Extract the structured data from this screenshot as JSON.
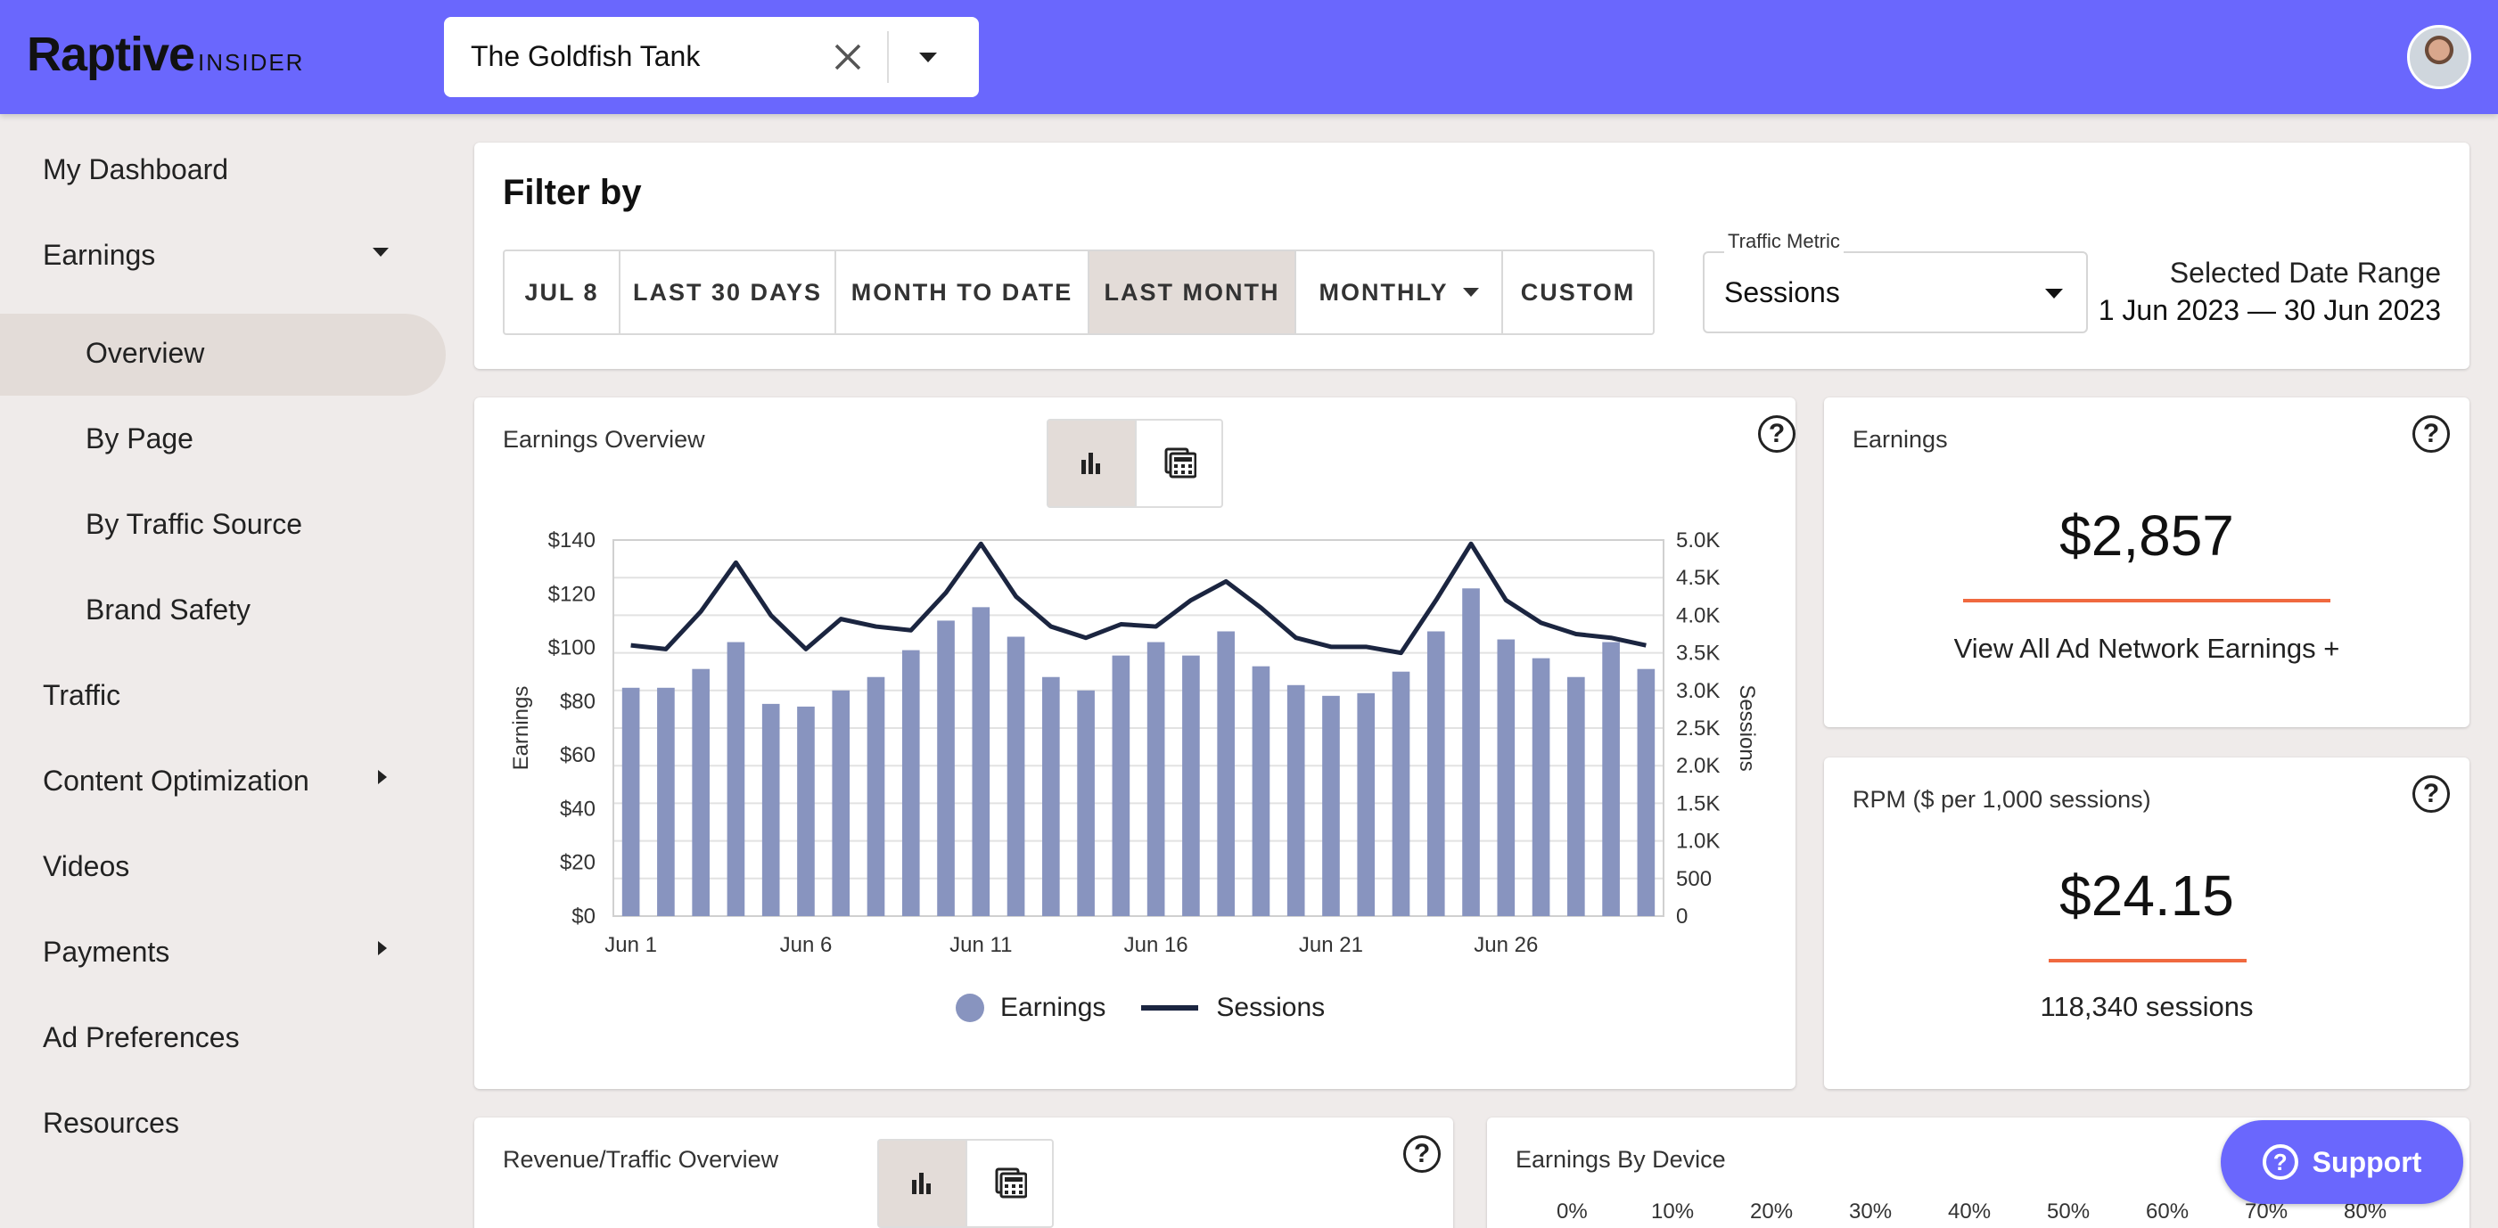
{
  "header": {
    "logo": "Raptive",
    "logo_sub": "INSIDER",
    "site_selector": {
      "value": "The Goldfish Tank"
    }
  },
  "sidebar": {
    "items": [
      {
        "label": "My Dashboard"
      },
      {
        "label": "Earnings"
      },
      {
        "label": "Overview"
      },
      {
        "label": "By Page"
      },
      {
        "label": "By Traffic Source"
      },
      {
        "label": "Brand Safety"
      },
      {
        "label": "Traffic"
      },
      {
        "label": "Content Optimization"
      },
      {
        "label": "Videos"
      },
      {
        "label": "Payments"
      },
      {
        "label": "Ad Preferences"
      },
      {
        "label": "Resources"
      }
    ]
  },
  "filter": {
    "title": "Filter by",
    "buttons": [
      "JUL 8",
      "LAST 30 DAYS",
      "MONTH TO DATE",
      "LAST MONTH",
      "MONTHLY",
      "CUSTOM"
    ],
    "active_button": "LAST MONTH",
    "traffic_metric_label": "Traffic Metric",
    "traffic_metric_value": "Sessions",
    "date_range_label": "Selected Date Range",
    "date_range_value": "1 Jun 2023 — 30 Jun 2023"
  },
  "earnings_overview": {
    "title": "Earnings Overview",
    "help": "?"
  },
  "chart_data": {
    "type": "bar",
    "title": "",
    "categories": [
      "Jun 1",
      "Jun 2",
      "Jun 3",
      "Jun 4",
      "Jun 5",
      "Jun 6",
      "Jun 7",
      "Jun 8",
      "Jun 9",
      "Jun 10",
      "Jun 11",
      "Jun 12",
      "Jun 13",
      "Jun 14",
      "Jun 15",
      "Jun 16",
      "Jun 17",
      "Jun 18",
      "Jun 19",
      "Jun 20",
      "Jun 21",
      "Jun 22",
      "Jun 23",
      "Jun 24",
      "Jun 25",
      "Jun 26",
      "Jun 27",
      "Jun 28",
      "Jun 29",
      "Jun 30"
    ],
    "x_tick_labels": [
      "Jun 1",
      "Jun 6",
      "Jun 11",
      "Jun 16",
      "Jun 21",
      "Jun 26"
    ],
    "series": [
      {
        "name": "Earnings",
        "type": "bar",
        "axis": "left",
        "color": "#8894bf",
        "values": [
          85,
          85,
          92,
          102,
          79,
          78,
          84,
          89,
          99,
          110,
          115,
          104,
          89,
          84,
          97,
          102,
          97,
          106,
          93,
          86,
          82,
          83,
          91,
          106,
          122,
          103,
          96,
          89,
          102,
          92
        ]
      },
      {
        "name": "Sessions",
        "type": "line",
        "axis": "right",
        "color": "#1b2540",
        "values": [
          3600,
          3550,
          4050,
          4700,
          4000,
          3550,
          3950,
          3850,
          3800,
          4300,
          4950,
          4250,
          3850,
          3700,
          3880,
          3850,
          4200,
          4450,
          4100,
          3700,
          3580,
          3580,
          3500,
          4200,
          4950,
          4200,
          3900,
          3750,
          3700,
          3600
        ]
      }
    ],
    "ylabel_left": "Earnings",
    "ylabel_right": "Sessions",
    "ylim_left": [
      0,
      140
    ],
    "ylim_right": [
      0,
      5000
    ],
    "y_ticks_left": [
      "$0",
      "$20",
      "$40",
      "$60",
      "$80",
      "$100",
      "$120",
      "$140"
    ],
    "y_ticks_right": [
      "0",
      "500",
      "1.0K",
      "1.5K",
      "2.0K",
      "2.5K",
      "3.0K",
      "3.5K",
      "4.0K",
      "4.5K",
      "5.0K"
    ],
    "grid": true,
    "legend": "bottom"
  },
  "earnings_card": {
    "title": "Earnings",
    "value": "$2,857",
    "link": "View All Ad Network Earnings +"
  },
  "rpm_card": {
    "title": "RPM ($ per 1,000 sessions)",
    "value": "$24.15",
    "sub": "118,340 sessions"
  },
  "revenue_traffic": {
    "title": "Revenue/Traffic Overview"
  },
  "earnings_device": {
    "title": "Earnings By Device",
    "ticks": [
      "0%",
      "10%",
      "20%",
      "30%",
      "40%",
      "50%",
      "60%",
      "70%",
      "80%"
    ]
  },
  "support": {
    "label": "Support"
  },
  "colors": {
    "accent": "#6a67fd",
    "bar": "#8894bf",
    "line": "#1b2540",
    "highlight": "#f0693f"
  }
}
